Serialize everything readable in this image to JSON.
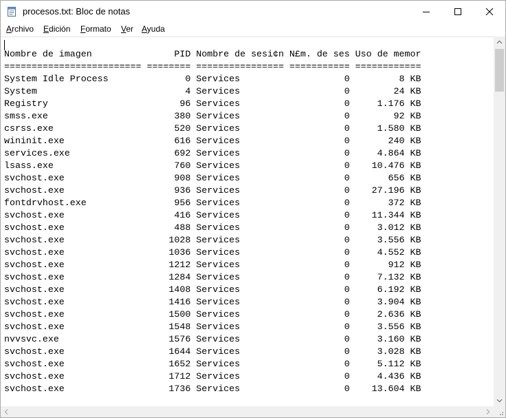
{
  "window": {
    "title": "procesos.txt: Bloc de notas"
  },
  "menu": [
    {
      "mnemonic": "A",
      "rest": "rchivo"
    },
    {
      "mnemonic": "E",
      "rest": "dición"
    },
    {
      "mnemonic": "F",
      "rest": "ormato"
    },
    {
      "mnemonic": "V",
      "rest": "er"
    },
    {
      "mnemonic": "A",
      "rest": "yuda"
    }
  ],
  "editor": {
    "header": "Nombre de imagen               PID Nombre de sesi¢n N£m. de ses Uso de memor",
    "separator": "========================= ======== ================ =========== ============",
    "rows": [
      [
        "System Idle Process",
        "0",
        "Services",
        "0",
        "8 KB"
      ],
      [
        "System",
        "4",
        "Services",
        "0",
        "24 KB"
      ],
      [
        "Registry",
        "96",
        "Services",
        "0",
        "1.176 KB"
      ],
      [
        "smss.exe",
        "380",
        "Services",
        "0",
        "92 KB"
      ],
      [
        "csrss.exe",
        "520",
        "Services",
        "0",
        "1.580 KB"
      ],
      [
        "wininit.exe",
        "616",
        "Services",
        "0",
        "240 KB"
      ],
      [
        "services.exe",
        "692",
        "Services",
        "0",
        "4.864 KB"
      ],
      [
        "lsass.exe",
        "760",
        "Services",
        "0",
        "10.476 KB"
      ],
      [
        "svchost.exe",
        "908",
        "Services",
        "0",
        "656 KB"
      ],
      [
        "svchost.exe",
        "936",
        "Services",
        "0",
        "27.196 KB"
      ],
      [
        "fontdrvhost.exe",
        "956",
        "Services",
        "0",
        "372 KB"
      ],
      [
        "svchost.exe",
        "416",
        "Services",
        "0",
        "11.344 KB"
      ],
      [
        "svchost.exe",
        "488",
        "Services",
        "0",
        "3.012 KB"
      ],
      [
        "svchost.exe",
        "1028",
        "Services",
        "0",
        "3.556 KB"
      ],
      [
        "svchost.exe",
        "1036",
        "Services",
        "0",
        "4.552 KB"
      ],
      [
        "svchost.exe",
        "1212",
        "Services",
        "0",
        "912 KB"
      ],
      [
        "svchost.exe",
        "1284",
        "Services",
        "0",
        "7.132 KB"
      ],
      [
        "svchost.exe",
        "1408",
        "Services",
        "0",
        "6.192 KB"
      ],
      [
        "svchost.exe",
        "1416",
        "Services",
        "0",
        "3.904 KB"
      ],
      [
        "svchost.exe",
        "1500",
        "Services",
        "0",
        "2.636 KB"
      ],
      [
        "svchost.exe",
        "1548",
        "Services",
        "0",
        "3.556 KB"
      ],
      [
        "nvvsvc.exe",
        "1576",
        "Services",
        "0",
        "3.160 KB"
      ],
      [
        "svchost.exe",
        "1644",
        "Services",
        "0",
        "3.028 KB"
      ],
      [
        "svchost.exe",
        "1652",
        "Services",
        "0",
        "5.112 KB"
      ],
      [
        "svchost.exe",
        "1712",
        "Services",
        "0",
        "4.436 KB"
      ],
      [
        "svchost.exe",
        "1736",
        "Services",
        "0",
        "13.604 KB"
      ]
    ]
  }
}
